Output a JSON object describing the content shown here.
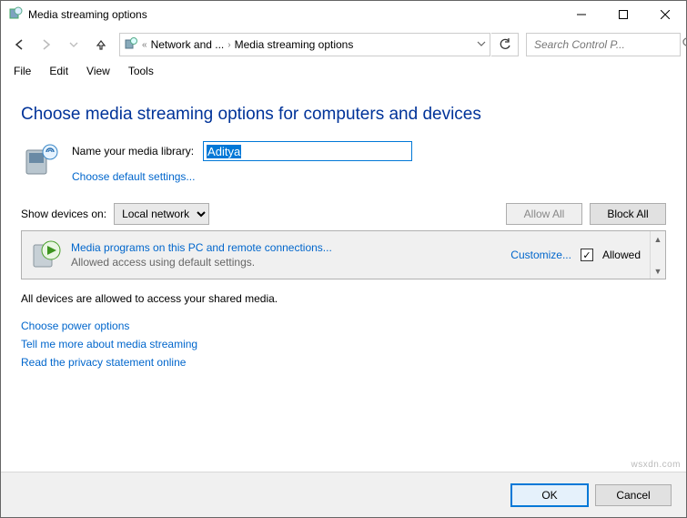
{
  "window": {
    "title": "Media streaming options"
  },
  "nav": {
    "crumb1": "Network and ...",
    "crumb2": "Media streaming options",
    "search_placeholder": "Search Control P..."
  },
  "menu": {
    "file": "File",
    "edit": "Edit",
    "view": "View",
    "tools": "Tools"
  },
  "main": {
    "heading": "Choose media streaming options for computers and devices",
    "name_label": "Name your media library:",
    "library_value": "Aditya",
    "choose_defaults": "Choose default settings...",
    "show_devices_label": "Show devices on:",
    "show_devices_value": "Local network",
    "allow_all": "Allow All",
    "block_all": "Block All",
    "device": {
      "title": "Media programs on this PC and remote connections...",
      "subtitle": "Allowed access using default settings.",
      "customize": "Customize...",
      "allowed": "Allowed"
    },
    "summary": "All devices are allowed to access your shared media.",
    "links": {
      "power": "Choose power options",
      "more": "Tell me more about media streaming",
      "privacy": "Read the privacy statement online"
    }
  },
  "footer": {
    "ok": "OK",
    "cancel": "Cancel"
  },
  "watermark": "wsxdn.com"
}
